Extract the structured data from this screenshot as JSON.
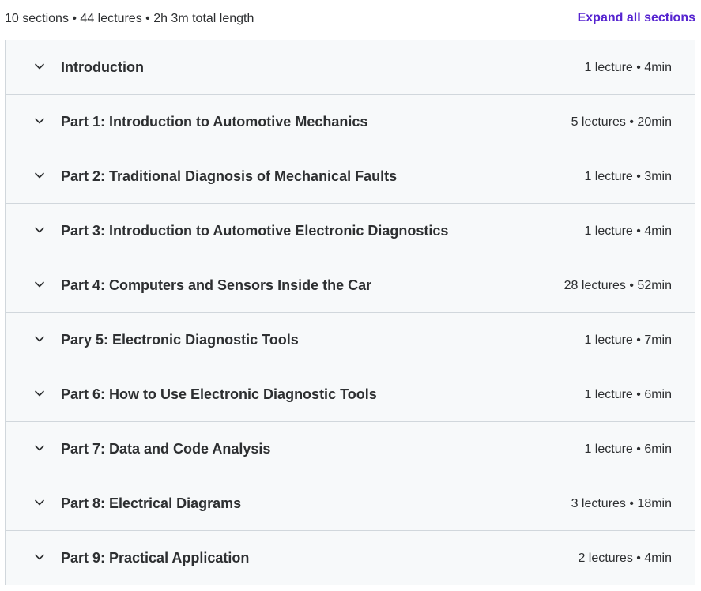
{
  "summary": {
    "text": "10 sections • 44 lectures • 2h 3m total length",
    "expand_label": "Expand all sections"
  },
  "colors": {
    "accent": "#5624d0",
    "text": "#2d2f31",
    "section_bg": "#f7f9fa",
    "border": "#d1d7dc"
  },
  "sections": [
    {
      "title": "Introduction",
      "meta": "1 lecture • 4min",
      "icon": "chevron-down-icon"
    },
    {
      "title": "Part 1: Introduction to Automotive Mechanics",
      "meta": "5 lectures • 20min",
      "icon": "chevron-down-icon"
    },
    {
      "title": "Part 2: Traditional Diagnosis of Mechanical Faults",
      "meta": "1 lecture • 3min",
      "icon": "chevron-down-icon"
    },
    {
      "title": "Part 3: Introduction to Automotive Electronic Diagnostics",
      "meta": "1 lecture • 4min",
      "icon": "chevron-down-icon"
    },
    {
      "title": "Part 4: Computers and Sensors Inside the Car",
      "meta": "28 lectures • 52min",
      "icon": "chevron-down-icon"
    },
    {
      "title": "Pary 5: Electronic Diagnostic Tools",
      "meta": "1 lecture • 7min",
      "icon": "chevron-down-icon"
    },
    {
      "title": "Part 6: How to Use Electronic Diagnostic Tools",
      "meta": "1 lecture • 6min",
      "icon": "chevron-down-icon"
    },
    {
      "title": "Part 7: Data and Code Analysis",
      "meta": "1 lecture • 6min",
      "icon": "chevron-down-icon"
    },
    {
      "title": "Part 8: Electrical Diagrams",
      "meta": "3 lectures • 18min",
      "icon": "chevron-down-icon"
    },
    {
      "title": "Part 9: Practical Application",
      "meta": "2 lectures • 4min",
      "icon": "chevron-down-icon"
    }
  ]
}
